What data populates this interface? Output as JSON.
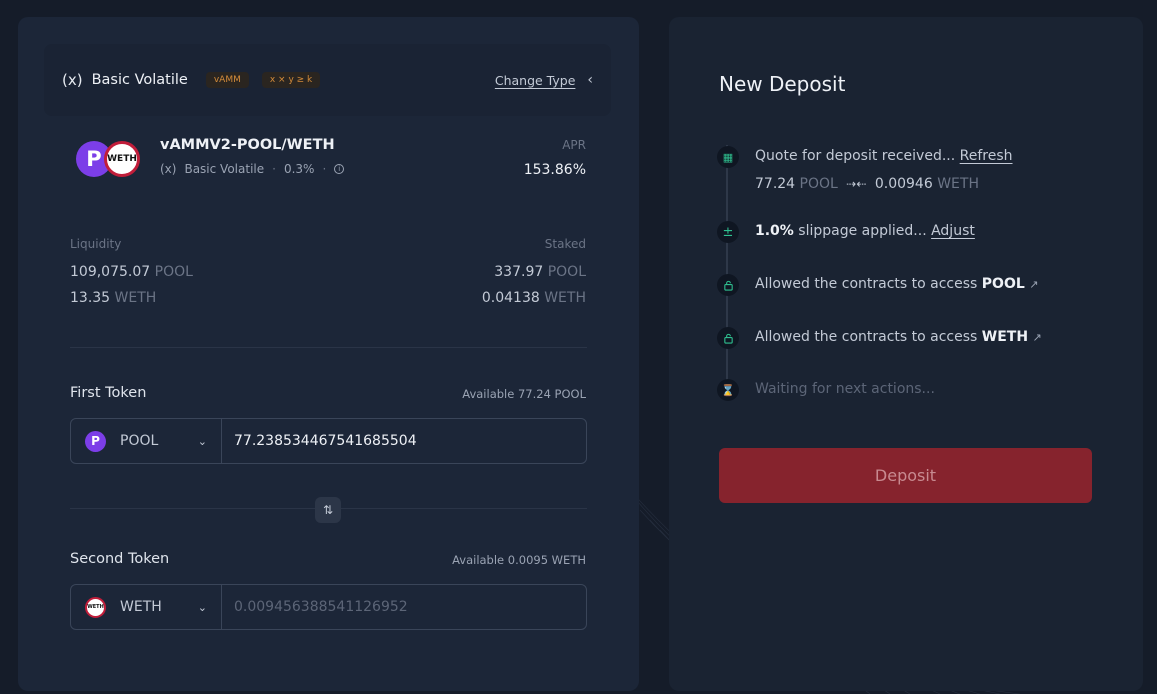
{
  "pool_type": {
    "icon": "(x)",
    "name": "Basic Volatile",
    "tags": [
      "vAMM",
      "x × y ≥ k"
    ],
    "change_label": "Change Type"
  },
  "pair": {
    "name": "vAMMV2-POOL/WETH",
    "type": "Basic Volatile",
    "fee": "0.3%",
    "apr_label": "APR",
    "apr_value": "153.86%"
  },
  "stats": {
    "liquidity_label": "Liquidity",
    "staked_label": "Staked",
    "liquidity": [
      {
        "amount": "109,075.07",
        "unit": "POOL"
      },
      {
        "amount": "13.35",
        "unit": "WETH"
      }
    ],
    "staked": [
      {
        "amount": "337.97",
        "unit": "POOL"
      },
      {
        "amount": "0.04138",
        "unit": "WETH"
      }
    ]
  },
  "first_token": {
    "label": "First Token",
    "available": "Available 77.24 POOL",
    "symbol": "POOL",
    "value": "77.238534467541685504"
  },
  "second_token": {
    "label": "Second Token",
    "available": "Available 0.0095 WETH",
    "symbol": "WETH",
    "placeholder": "0.009456388541126952"
  },
  "deposit": {
    "title": "New Deposit",
    "steps": {
      "quote": {
        "text": "Quote for deposit received...",
        "link": "Refresh"
      },
      "quote_values": {
        "amount1": "77.24",
        "unit1": "POOL",
        "amount2": "0.00946",
        "unit2": "WETH"
      },
      "slippage": {
        "bold": "1.0%",
        "text": "slippage applied...",
        "link": "Adjust"
      },
      "allow_pool": {
        "text": "Allowed the contracts to access",
        "token": "POOL"
      },
      "allow_weth": {
        "text": "Allowed the contracts to access",
        "token": "WETH"
      },
      "waiting": {
        "text": "Waiting for next actions..."
      }
    },
    "button_label": "Deposit"
  },
  "icons": {
    "calculator": "calculator-icon",
    "plus_minus": "plus-minus-icon",
    "lock": "lock-icon",
    "hourglass": "hourglass-icon",
    "external_link": "external-link-icon",
    "swap": "swap-arrows-icon"
  },
  "colors": {
    "accent_green": "#2fbf8f",
    "accent_orange": "#e0a031",
    "deposit_button": "#86232d",
    "pool_purple": "#7c3ee8",
    "weth_red": "#c11d3a"
  }
}
